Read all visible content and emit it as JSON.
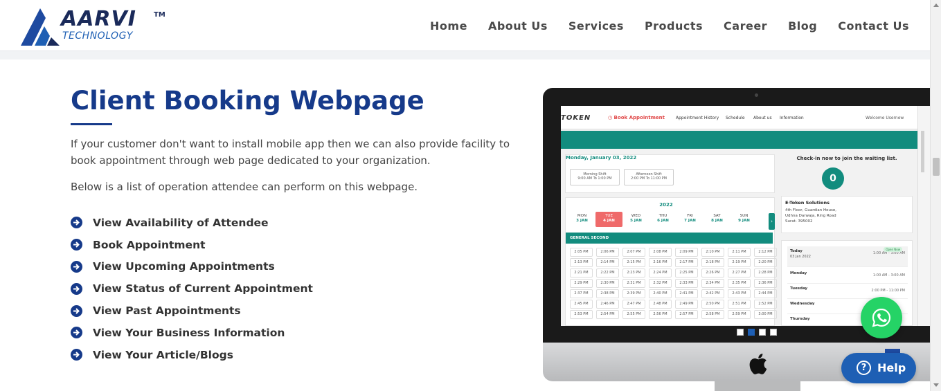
{
  "header": {
    "logo_text": "AARVI",
    "logo_tm": "TM",
    "logo_sub": "TECHNOLOGY",
    "nav": [
      "Home",
      "About Us",
      "Services",
      "Products",
      "Career",
      "Blog",
      "Contact Us"
    ]
  },
  "main": {
    "title": "Client Booking Webpage",
    "paragraph1": "If your customer don't want to install mobile app then we can also provide facility to book appointment through web page dedicated to your organization.",
    "paragraph2": "Below is a list of operation attendee can perform on this webpage.",
    "features": [
      "View Availability of Attendee",
      "Book Appointment",
      "View Upcoming Appointments",
      "View Status of Current Appointment",
      "View Past Appointments",
      "View Your Business Information",
      "View Your Article/Blogs"
    ]
  },
  "screen": {
    "logo": "TOKEN",
    "book_link": "Book Appointment",
    "nav_items": [
      "Appointment History",
      "Schedule",
      "About us",
      "Information"
    ],
    "welcome": "Welcome Usernew",
    "date_heading": "Monday, January 03, 2022",
    "shifts": [
      {
        "name": "Morning Shift",
        "time": "9:00 AM To 1:00 PM"
      },
      {
        "name": "Afternoon Shift",
        "time": "2:00 PM To 11:00 PM"
      }
    ],
    "checkin_text": "Check-in now to join the waiting list.",
    "queue_count": "0",
    "year": "2022",
    "days": [
      {
        "d": "MON",
        "date": "3 JAN"
      },
      {
        "d": "TUE",
        "date": "4 JAN"
      },
      {
        "d": "WED",
        "date": "5 JAN"
      },
      {
        "d": "THU",
        "date": "6 JAN"
      },
      {
        "d": "FRI",
        "date": "7 JAN"
      },
      {
        "d": "SAT",
        "date": "8 JAN"
      },
      {
        "d": "SUN",
        "date": "9 JAN"
      }
    ],
    "section": "GENERAL SECOND",
    "slots": [
      "2:05 PM",
      "2:06 PM",
      "2:07 PM",
      "2:08 PM",
      "2:09 PM",
      "2:10 PM",
      "2:11 PM",
      "2:12 PM",
      "2:13 PM",
      "2:14 PM",
      "2:15 PM",
      "2:16 PM",
      "2:17 PM",
      "2:18 PM",
      "2:19 PM",
      "2:20 PM",
      "2:21 PM",
      "2:22 PM",
      "2:23 PM",
      "2:24 PM",
      "2:25 PM",
      "2:26 PM",
      "2:27 PM",
      "2:28 PM",
      "2:29 PM",
      "2:30 PM",
      "2:31 PM",
      "2:32 PM",
      "2:33 PM",
      "2:34 PM",
      "2:35 PM",
      "2:36 PM",
      "2:37 PM",
      "2:38 PM",
      "2:39 PM",
      "2:40 PM",
      "2:41 PM",
      "2:42 PM",
      "2:43 PM",
      "2:44 PM",
      "2:45 PM",
      "2:46 PM",
      "2:47 PM",
      "2:48 PM",
      "2:49 PM",
      "2:50 PM",
      "2:51 PM",
      "2:52 PM",
      "2:53 PM",
      "2:54 PM",
      "2:55 PM",
      "2:56 PM",
      "2:57 PM",
      "2:58 PM",
      "2:59 PM",
      "3:00 PM"
    ],
    "company_name": "E-Token Solutions",
    "company_address": [
      "4th Floor, Guardian House,",
      "Udhna Darwaja, Ring Road",
      "Surat- 395002"
    ],
    "open_badge": "Open Now",
    "schedule": [
      {
        "day": "Today",
        "sub": "03 Jan 2022",
        "time": "1:00 AM - 3:00 AM"
      },
      {
        "day": "Monday",
        "sub": "",
        "time": "1:00 AM - 3:00 AM"
      },
      {
        "day": "Tuesday",
        "sub": "",
        "time": "2:00 PM - 11:00 PM"
      },
      {
        "day": "Wednesday",
        "sub": "",
        "time": ""
      },
      {
        "day": "Thursday",
        "sub": "",
        "time": ""
      }
    ]
  },
  "carousel": {
    "count": 4,
    "active": 2
  },
  "help_button": {
    "label": "Help",
    "icon": "?"
  },
  "colors": {
    "brand": "#163a8a",
    "teal": "#128c7e",
    "help": "#1e5fb4",
    "whatsapp": "#25d366"
  }
}
